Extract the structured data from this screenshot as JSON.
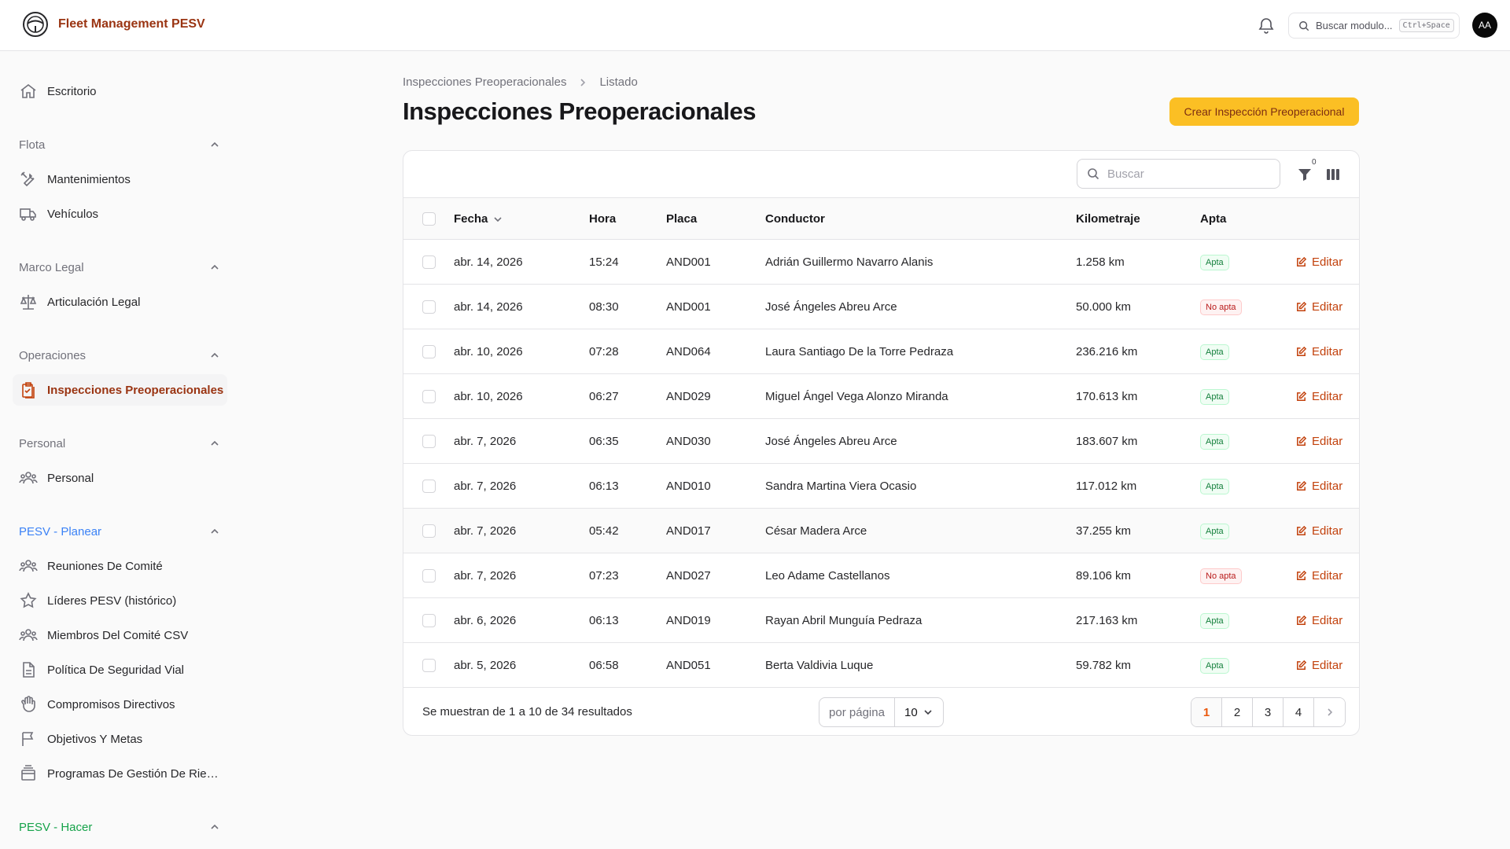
{
  "app": {
    "title": "Fleet Management PESV"
  },
  "header": {
    "search_placeholder": "Buscar modulo...",
    "search_shortcut": "Ctrl+Space",
    "avatar_initials": "AA"
  },
  "sidebar": {
    "escritorio": "Escritorio",
    "groups": {
      "flota": {
        "label": "Flota",
        "items": [
          "Mantenimientos",
          "Vehículos"
        ]
      },
      "marco_legal": {
        "label": "Marco Legal",
        "items": [
          "Articulación Legal"
        ]
      },
      "operaciones": {
        "label": "Operaciones",
        "items": [
          "Inspecciones Preoperacionales"
        ]
      },
      "personal": {
        "label": "Personal",
        "items": [
          "Personal"
        ]
      },
      "planear": {
        "label": "PESV - Planear",
        "color": "#3b82f6",
        "items": [
          "Reuniones De Comité",
          "Líderes PESV (histórico)",
          "Miembros Del Comité CSV",
          "Política De Seguridad Vial",
          "Compromisos Directivos",
          "Objetivos Y Metas",
          "Programas De Gestión De Riesgos"
        ]
      },
      "hacer": {
        "label": "PESV - Hacer",
        "color": "#16a34a"
      }
    }
  },
  "breadcrumb": {
    "parent": "Inspecciones Preoperacionales",
    "current": "Listado"
  },
  "page": {
    "title": "Inspecciones Preoperacionales",
    "create_label": "Crear Inspección Preoperacional"
  },
  "table": {
    "search_placeholder": "Buscar",
    "filter_count": "0",
    "columns": {
      "fecha": "Fecha",
      "hora": "Hora",
      "placa": "Placa",
      "conductor": "Conductor",
      "kilometraje": "Kilometraje",
      "apta": "Apta"
    },
    "edit_label": "Editar",
    "rows": [
      {
        "fecha": "abr. 14, 2026",
        "hora": "15:24",
        "placa": "AND001",
        "conductor": "Adrián Guillermo Navarro Alanis",
        "km": "1.258 km",
        "apta": "Apta"
      },
      {
        "fecha": "abr. 14, 2026",
        "hora": "08:30",
        "placa": "AND001",
        "conductor": "José Ángeles Abreu Arce",
        "km": "50.000 km",
        "apta": "No apta"
      },
      {
        "fecha": "abr. 10, 2026",
        "hora": "07:28",
        "placa": "AND064",
        "conductor": "Laura Santiago De la Torre Pedraza",
        "km": "236.216 km",
        "apta": "Apta"
      },
      {
        "fecha": "abr. 10, 2026",
        "hora": "06:27",
        "placa": "AND029",
        "conductor": "Miguel Ángel Vega Alonzo Miranda",
        "km": "170.613 km",
        "apta": "Apta"
      },
      {
        "fecha": "abr. 7, 2026",
        "hora": "06:35",
        "placa": "AND030",
        "conductor": "José Ángeles Abreu Arce",
        "km": "183.607 km",
        "apta": "Apta"
      },
      {
        "fecha": "abr. 7, 2026",
        "hora": "06:13",
        "placa": "AND010",
        "conductor": "Sandra Martina Viera Ocasio",
        "km": "117.012 km",
        "apta": "Apta"
      },
      {
        "fecha": "abr. 7, 2026",
        "hora": "05:42",
        "placa": "AND017",
        "conductor": "César Madera Arce",
        "km": "37.255 km",
        "apta": "Apta"
      },
      {
        "fecha": "abr. 7, 2026",
        "hora": "07:23",
        "placa": "AND027",
        "conductor": "Leo Adame Castellanos",
        "km": "89.106 km",
        "apta": "No apta"
      },
      {
        "fecha": "abr. 6, 2026",
        "hora": "06:13",
        "placa": "AND019",
        "conductor": "Rayan Abril Munguía Pedraza",
        "km": "217.163 km",
        "apta": "Apta"
      },
      {
        "fecha": "abr. 5, 2026",
        "hora": "06:58",
        "placa": "AND051",
        "conductor": "Berta Valdivia Luque",
        "km": "59.782 km",
        "apta": "Apta"
      }
    ]
  },
  "footer": {
    "summary": "Se muestran de 1 a 10 de 34 resultados",
    "per_page_label": "por página",
    "per_page_value": "10",
    "pages": [
      "1",
      "2",
      "3",
      "4"
    ],
    "current_page": "1"
  }
}
